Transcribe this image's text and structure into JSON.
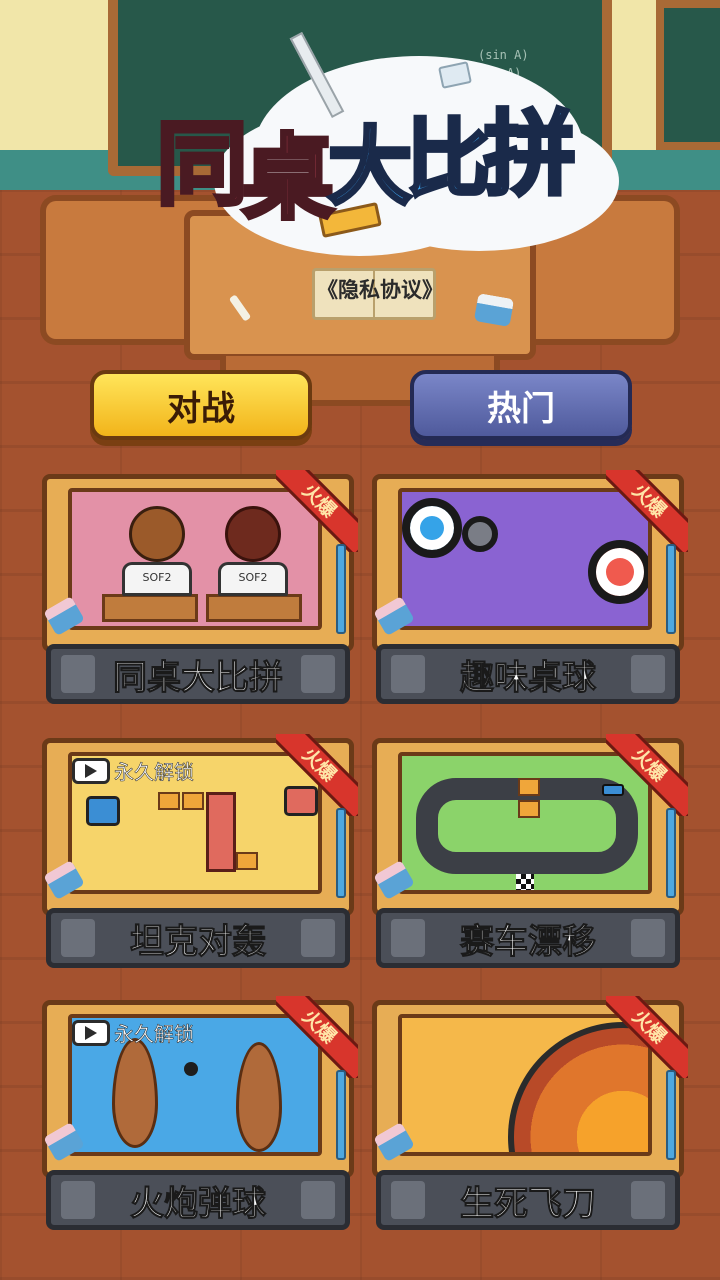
{
  "app": {
    "title_chars": [
      "同",
      "桌",
      "大",
      "比",
      "拼"
    ],
    "privacy_link": "《隐私协议》"
  },
  "tabs": [
    {
      "label": "对战",
      "active": true,
      "color": "#f7c933"
    },
    {
      "label": "热门",
      "active": false,
      "color": "#5f6bb0"
    }
  ],
  "hot_badge": "火爆",
  "unlock_label": "永久解锁",
  "games": [
    {
      "title": "同桌大比拼",
      "hot": true,
      "locked": false,
      "scene": "classmates-at-desks"
    },
    {
      "title": "趣味桌球",
      "hot": true,
      "locked": false,
      "scene": "air-hockey"
    },
    {
      "title": "坦克对轰",
      "hot": true,
      "locked": true,
      "scene": "tank-battle"
    },
    {
      "title": "赛车漂移",
      "hot": true,
      "locked": false,
      "scene": "race-track"
    },
    {
      "title": "火炮弹球",
      "hot": true,
      "locked": true,
      "scene": "cannon-boats"
    },
    {
      "title": "生死飞刀",
      "hot": true,
      "locked": false,
      "scene": "knife-target"
    }
  ],
  "scene_text": {
    "shirt_label": "SOF2"
  },
  "colors": {
    "title_pink": "#f05b6e",
    "title_blue": "#3aa2ee",
    "hot_ribbon": "#d8352c",
    "label_bar": "#4b4f58"
  }
}
